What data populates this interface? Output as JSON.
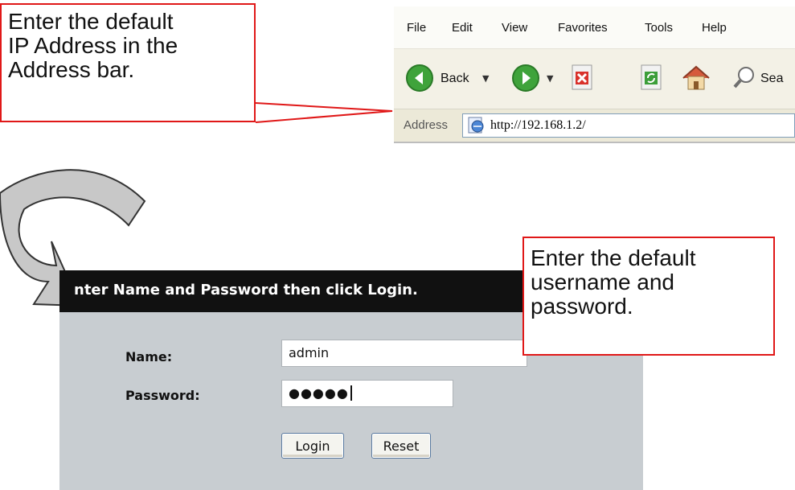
{
  "browser": {
    "menu": [
      "File",
      "Edit",
      "View",
      "Favorites",
      "Tools",
      "Help"
    ],
    "toolbar": {
      "back_label": "Back",
      "search_label": "Sea"
    },
    "address": {
      "label": "Address",
      "url": "http://192.168.1.2/"
    }
  },
  "callouts": {
    "address": [
      "Enter the default",
      "IP Address in the",
      "Address bar."
    ],
    "credentials": [
      "Enter the default",
      "username and",
      "password."
    ]
  },
  "login": {
    "header": "nter Name and Password then click Login.",
    "name_label": "Name:",
    "name_value": "admin",
    "password_label": "Password:",
    "password_masked": "●●●●●",
    "login_button": "Login",
    "reset_button": "Reset"
  },
  "colors": {
    "callout_border": "#e01818",
    "login_header_bg": "#111111",
    "login_body_bg": "#c8cdd1",
    "arrow_fill": "#c8c8c8"
  }
}
